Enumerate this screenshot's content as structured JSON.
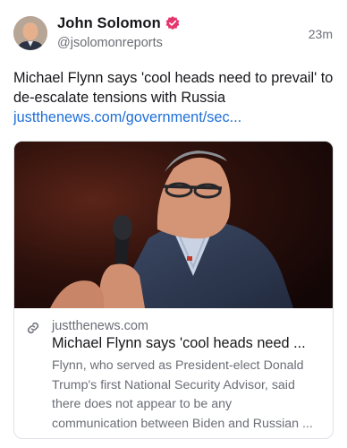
{
  "author": {
    "display_name": "John Solomon",
    "handle": "@jsolomonreports",
    "avatar_icon": "avatar-photo",
    "verified_icon": "verified-badge-icon",
    "verified_color": "#e5366e"
  },
  "timestamp": "23m",
  "post": {
    "text": "Michael Flynn says 'cool heads need to prevail' to de-escalate tensions with Russia",
    "link_text": "justthenews.com/government/sec..."
  },
  "link_card": {
    "image_alt_icon": "speaker-photo",
    "domain": "justthenews.com",
    "title": "Michael Flynn says 'cool heads need ...",
    "description_lines": [
      "Flynn, who served as President-elect Donald",
      "Trump's first National Security Advisor, said",
      "there does not appear to be any",
      "communication between Biden and Russian ..."
    ]
  },
  "colors": {
    "link": "#1d6fd8",
    "secondary_text": "#6b6e76",
    "primary_text": "#17171b",
    "card_border": "#dfe1e6"
  }
}
